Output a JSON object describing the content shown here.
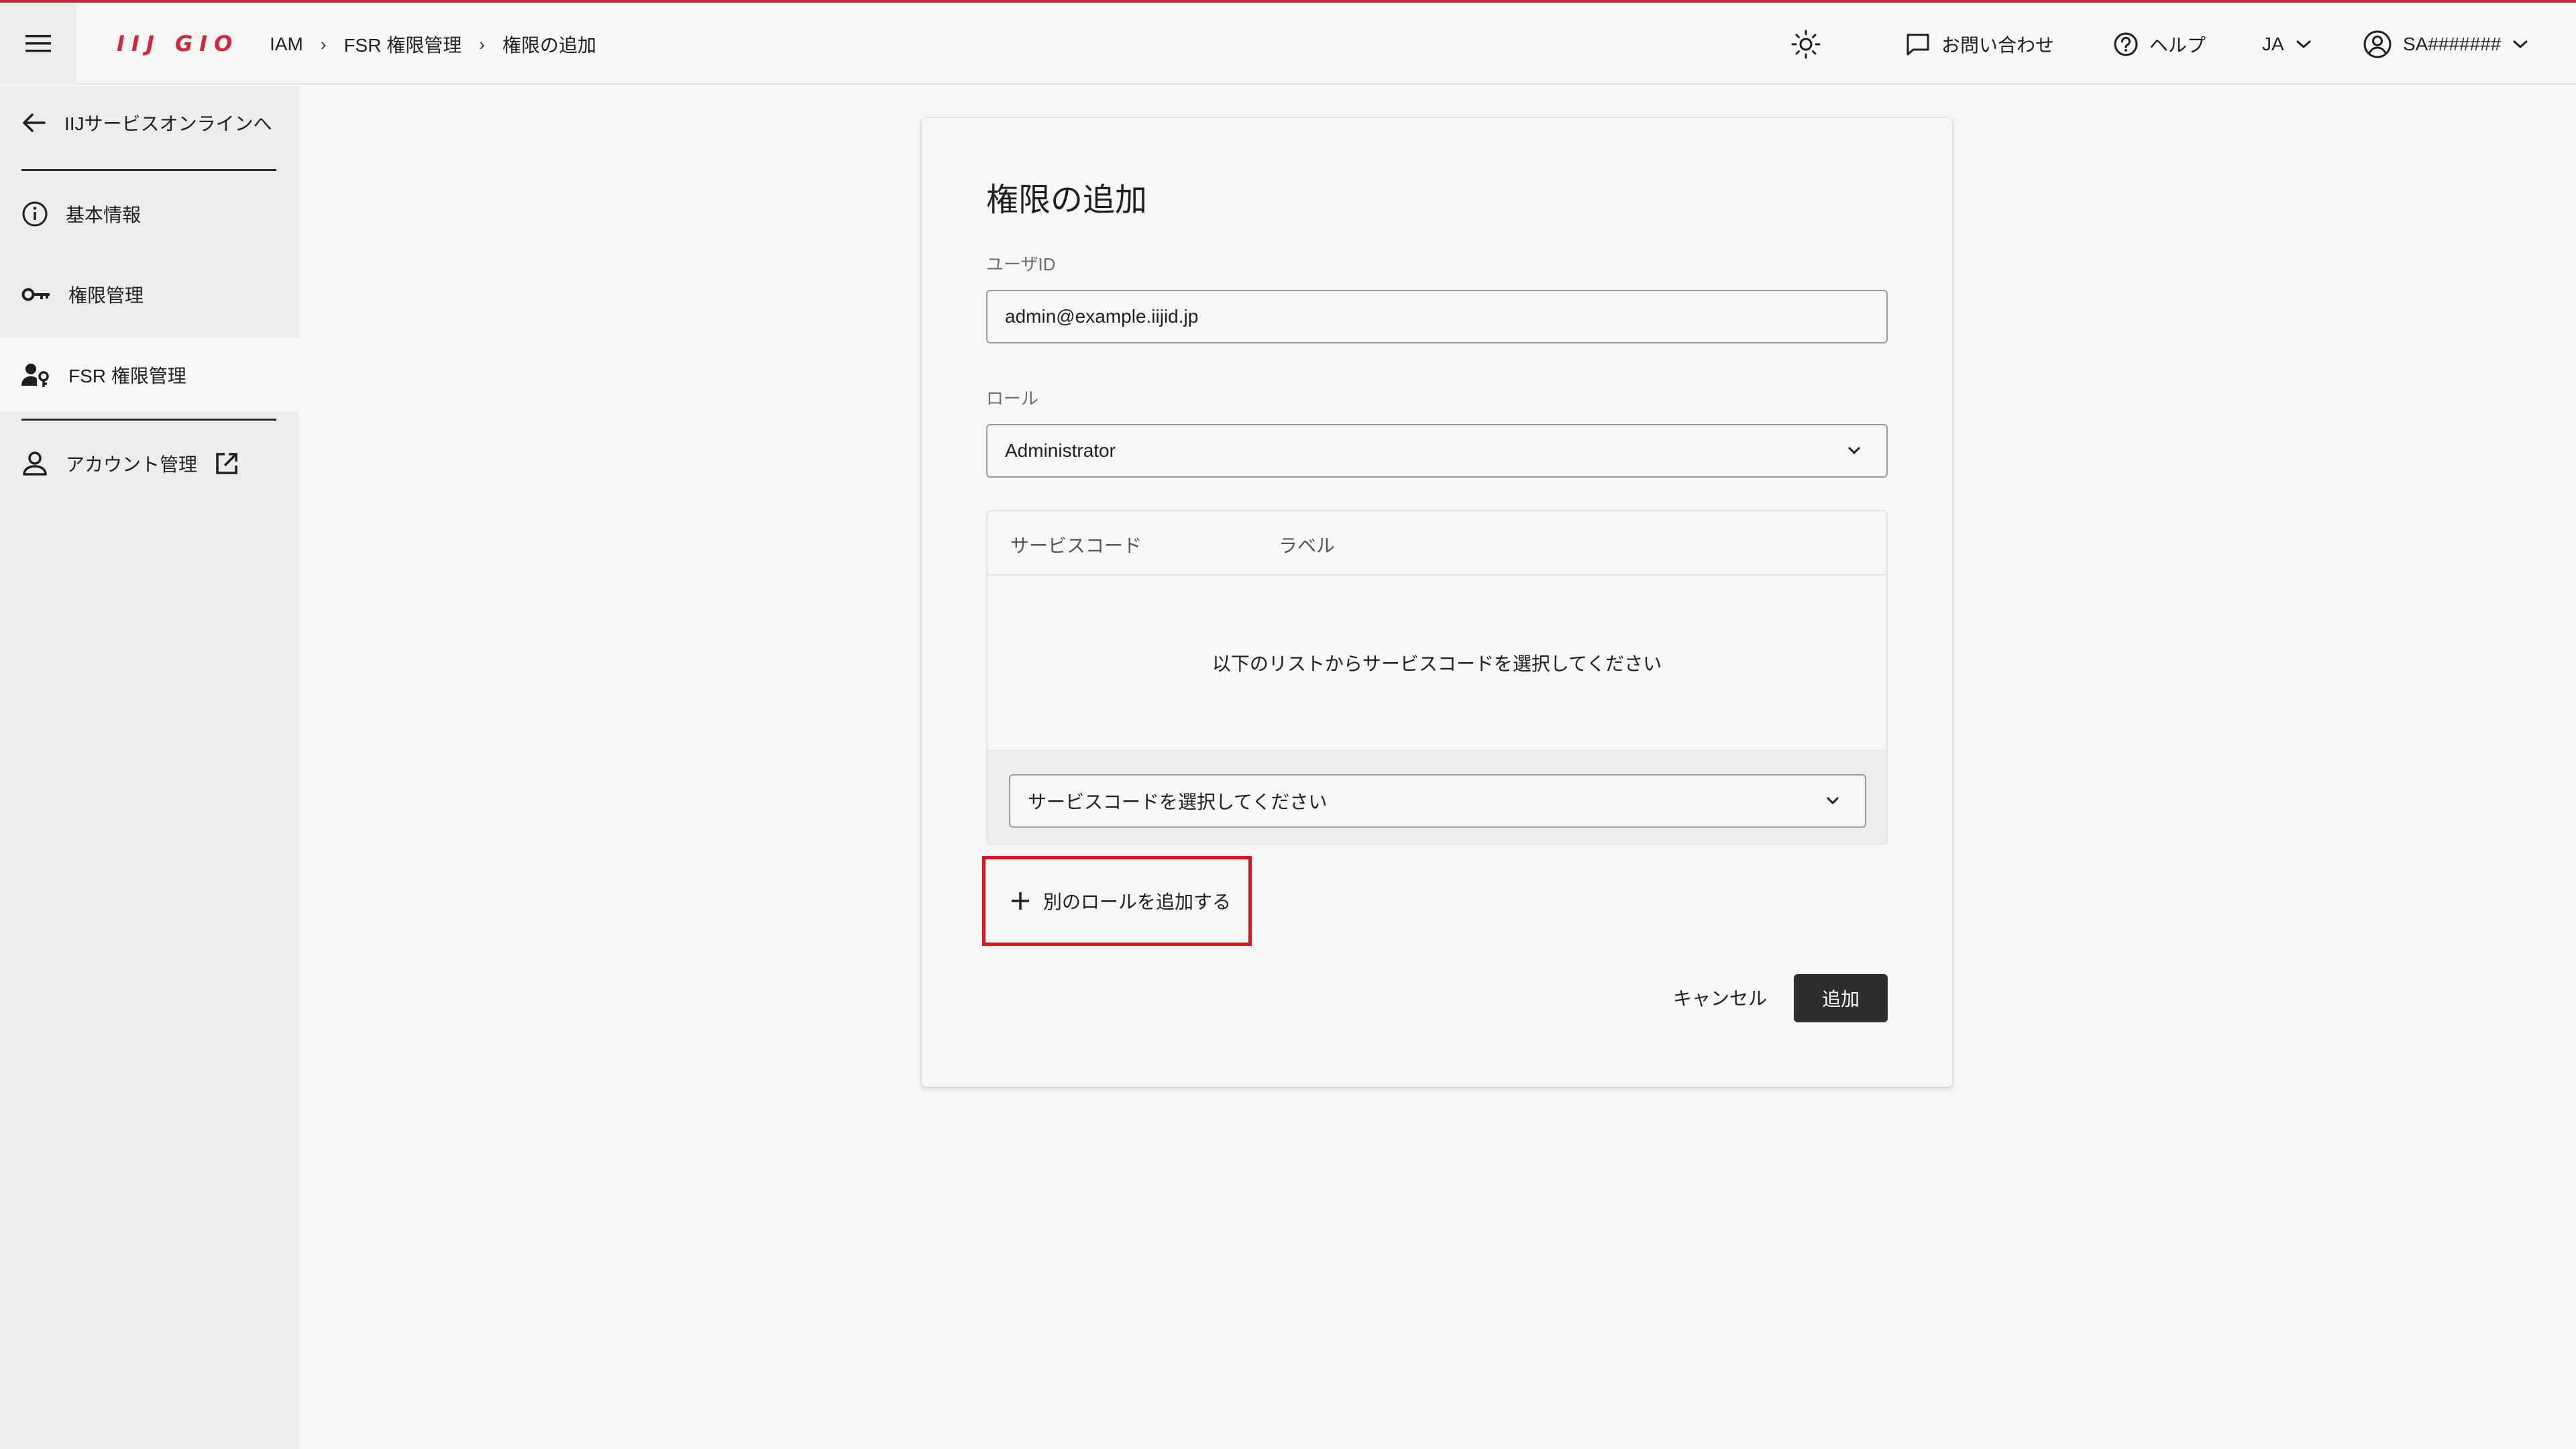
{
  "header": {
    "logo": "IIJ GIO",
    "breadcrumb": [
      "IAM",
      "FSR 権限管理",
      "権限の追加"
    ],
    "breadcrumb_separator": "›",
    "contact": "お問い合わせ",
    "help": "ヘルプ",
    "language": "JA",
    "user": "SA#######",
    "icons": {
      "menu": "hamburger-icon",
      "theme": "sun-icon",
      "contact": "chat-bubble-icon",
      "help": "question-circle-icon",
      "user": "user-circle-icon"
    }
  },
  "sidebar": {
    "back": "IIJサービスオンラインへ",
    "items": [
      {
        "label": "基本情報",
        "icon": "info-icon",
        "active": false
      },
      {
        "label": "権限管理",
        "icon": "key-icon",
        "active": false
      },
      {
        "label": "FSR 権限管理",
        "icon": "user-key-icon",
        "active": true
      }
    ],
    "account": "アカウント管理"
  },
  "form": {
    "title": "権限の追加",
    "user_id_label": "ユーザID",
    "user_id_value": "admin@example.iijid.jp",
    "role_label": "ロール",
    "role_value": "Administrator",
    "service_table": {
      "columns": [
        "サービスコード",
        "ラベル"
      ],
      "empty_message": "以下のリストからサービスコードを選択してください",
      "select_placeholder": "サービスコードを選択してください"
    },
    "add_role": "別のロールを追加する",
    "cancel": "キャンセル",
    "submit": "追加"
  },
  "colors": {
    "brand_red": "#d3263a",
    "highlight_red": "#e0131e",
    "primary_button": "#2e2e2e",
    "sidebar_bg": "#ececea",
    "page_bg": "#f7f7f6"
  }
}
